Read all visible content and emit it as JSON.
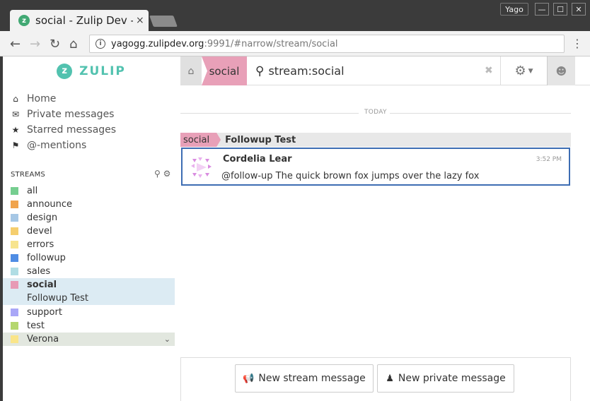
{
  "browser": {
    "tab_title": "social - Zulip Dev - Z",
    "tab_close": "×",
    "profile_name": "Yago",
    "minimize": "—",
    "maximize": "☐",
    "close": "✕",
    "url_host": "yagogg.zulipdev.org",
    "url_rest": ":9991/#narrow/stream/social"
  },
  "app": {
    "logo_text": "ZULIP",
    "logo_glyph": "z"
  },
  "navbar": {
    "stream_crumb": "social",
    "search_text": "stream:social"
  },
  "sidebar": {
    "nav": [
      {
        "label": "Home",
        "icon": "home-icon"
      },
      {
        "label": "Private messages",
        "icon": "envelope-icon"
      },
      {
        "label": "Starred messages",
        "icon": "star-icon"
      },
      {
        "label": "@-mentions",
        "icon": "tag-icon"
      }
    ],
    "streams_header": "STREAMS",
    "streams": [
      {
        "name": "all",
        "color": "#76ce90"
      },
      {
        "name": "announce",
        "color": "#f0a44d"
      },
      {
        "name": "design",
        "color": "#a6c7e5"
      },
      {
        "name": "devel",
        "color": "#f5ce6e"
      },
      {
        "name": "errors",
        "color": "#f7e48e"
      },
      {
        "name": "followup",
        "color": "#4f8de4"
      },
      {
        "name": "sales",
        "color": "#b0dde4"
      },
      {
        "name": "social",
        "color": "#e79ab5"
      },
      {
        "name": "support",
        "color": "#a9a7f7"
      },
      {
        "name": "test",
        "color": "#b5d76e"
      },
      {
        "name": "Verona",
        "color": "#fae589"
      }
    ],
    "active_topic": "Followup Test"
  },
  "main": {
    "date_divider": "TODAY",
    "recipient_stream": "social",
    "recipient_topic": "Followup Test",
    "message": {
      "sender": "Cordelia Lear",
      "time": "3:52 PM",
      "content": "@follow-up The quick brown fox jumps over the lazy fox"
    },
    "compose": {
      "new_stream_label": "New stream message",
      "new_private_label": "New private message"
    }
  },
  "colors": {
    "brand": "#52c2af",
    "selected_border": "#3d6db3",
    "social": "#e8a0b8"
  }
}
